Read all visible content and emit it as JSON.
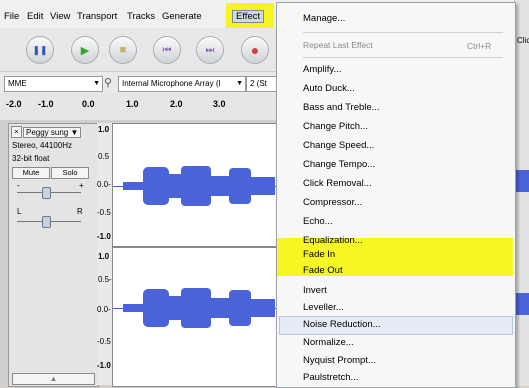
{
  "menubar": {
    "items": [
      "File",
      "Edit",
      "View",
      "Transport",
      "Tracks",
      "Generate",
      "Effect"
    ]
  },
  "transport": {
    "pause_symbol": "❚❚",
    "play_symbol": "▶",
    "stop_symbol": "■",
    "skip_start_symbol": "⏮",
    "skip_end_symbol": "⏭",
    "record_symbol": "●"
  },
  "devices": {
    "host": "MME",
    "input": "Internal Microphone Array (I",
    "channels": "2 (St"
  },
  "ruler": {
    "ticks": [
      "-2.0",
      "-1.0",
      "0.0",
      "1.0",
      "2.0",
      "3.0"
    ]
  },
  "track": {
    "close": "×",
    "name": "Peggy sung ▼",
    "info_rate": "Stereo, 44100Hz",
    "info_format": "32-bit float",
    "mute": "Mute",
    "solo": "Solo",
    "gain_minus": "-",
    "gain_plus": "+",
    "pan_left": "L",
    "pan_right": "R",
    "collapse": "▲"
  },
  "scale": {
    "top": [
      "1.0",
      "0.5",
      "0.0-",
      "-0.5",
      "-1.0"
    ],
    "bottom": [
      "1.0",
      "0.5-",
      "0.0-",
      "-0.5",
      "-1.0"
    ]
  },
  "right_strip": {
    "label": "Clic"
  },
  "effect_menu": {
    "manage": "Manage...",
    "repeat_last": "Repeat Last Effect",
    "repeat_shortcut": "Ctrl+R",
    "effects": [
      "Amplify...",
      "Auto Duck...",
      "Bass and Treble...",
      "Change Pitch...",
      "Change Speed...",
      "Change Tempo...",
      "Click Removal...",
      "Compressor...",
      "Echo...",
      "Equalization...",
      "Fade In",
      "Fade Out",
      "Invert",
      "Leveller...",
      "Noise Reduction...",
      "Normalize...",
      "Nyquist Prompt...",
      "Paulstretch..."
    ]
  },
  "colors": {
    "highlight": "#f6f600",
    "waveform": "#4a63d9",
    "record": "#d04040",
    "play": "#2fa52f"
  }
}
